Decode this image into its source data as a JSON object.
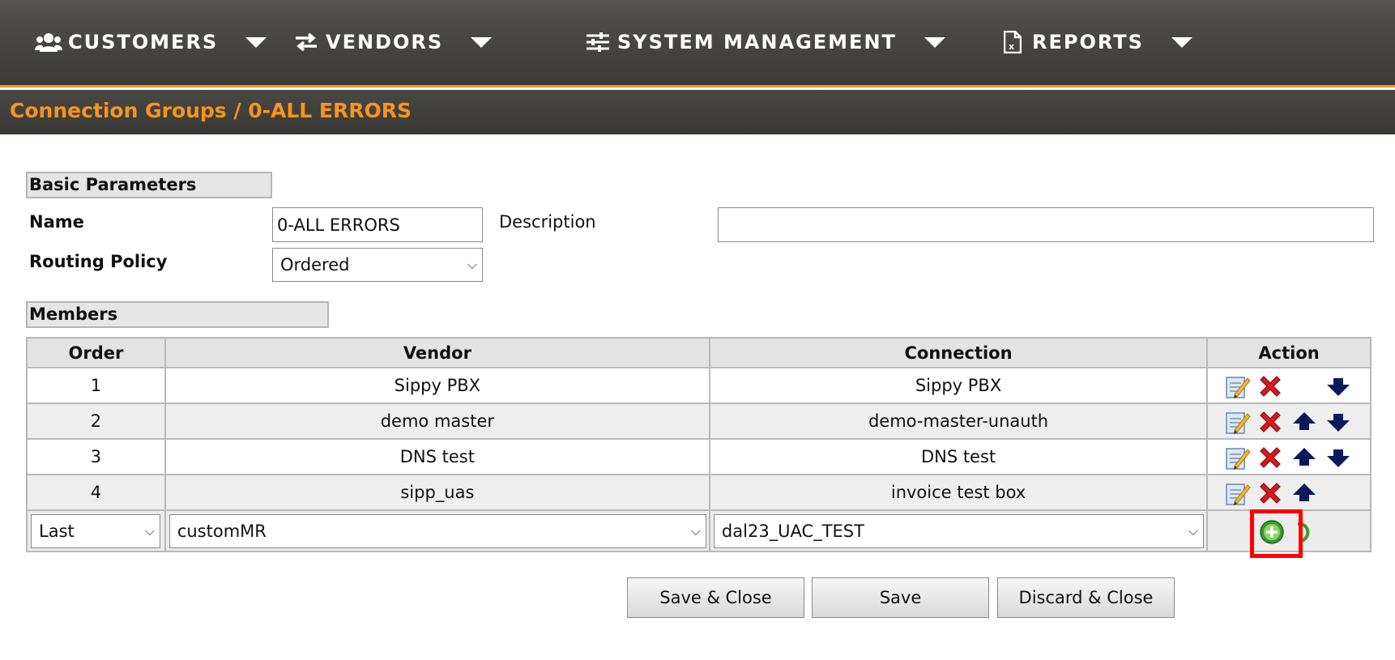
{
  "nav": {
    "items": [
      {
        "label": "CUSTOMERS",
        "icon": "users-icon"
      },
      {
        "label": "VENDORS",
        "icon": "exchange-arrows-icon"
      },
      {
        "label": "SYSTEM MANAGEMENT",
        "icon": "sliders-icon"
      },
      {
        "label": "REPORTS",
        "icon": "excel-file-icon"
      }
    ]
  },
  "breadcrumb": {
    "parent": "Connection Groups",
    "separator": " / ",
    "current": "0-ALL ERRORS"
  },
  "basic": {
    "header": "Basic Parameters",
    "name_label": "Name",
    "name_value": "0-ALL ERRORS",
    "description_label": "Description",
    "description_value": "",
    "routing_label": "Routing Policy",
    "routing_value": "Ordered"
  },
  "members": {
    "header": "Members",
    "columns": [
      "Order",
      "Vendor",
      "Connection",
      "Action"
    ],
    "rows": [
      {
        "order": "1",
        "vendor": "Sippy PBX",
        "connection": "Sippy PBX",
        "actions": [
          "edit-icon",
          "delete-icon",
          "move-down-icon"
        ]
      },
      {
        "order": "2",
        "vendor": "demo master",
        "connection": "demo-master-unauth",
        "actions": [
          "edit-icon",
          "delete-icon",
          "move-up-icon",
          "move-down-icon"
        ]
      },
      {
        "order": "3",
        "vendor": "DNS test",
        "connection": "DNS test",
        "actions": [
          "edit-icon",
          "delete-icon",
          "move-up-icon",
          "move-down-icon"
        ]
      },
      {
        "order": "4",
        "vendor": "sipp_uas",
        "connection": "invoice test box",
        "actions": [
          "edit-icon",
          "delete-icon",
          "move-up-icon"
        ]
      }
    ],
    "add_row": {
      "order_value": "Last",
      "vendor_value": "customMR",
      "connection_value": "dal23_UAC_TEST"
    }
  },
  "buttons": {
    "save_close": "Save & Close",
    "save": "Save",
    "discard_close": "Discard & Close"
  },
  "colors": {
    "accent": "#f7941d",
    "nav_bg": "#4a4845",
    "highlight": "#ff0000",
    "delete_red": "#d9181f",
    "arrow_navy": "#0a1a5c",
    "add_green": "#3a9a2a"
  }
}
